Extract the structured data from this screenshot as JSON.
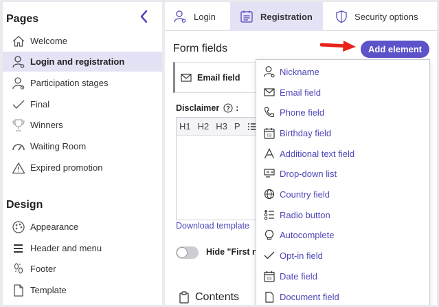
{
  "sidebar": {
    "pages_heading": "Pages",
    "design_heading": "Design",
    "pages_items": [
      {
        "label": "Welcome",
        "icon": "home-icon"
      },
      {
        "label": "Login and registration",
        "icon": "user-key-icon",
        "active": true
      },
      {
        "label": "Participation stages",
        "icon": "user-gear-icon"
      },
      {
        "label": "Final",
        "icon": "checkmark-icon"
      },
      {
        "label": "Winners",
        "icon": "trophy-icon"
      },
      {
        "label": "Waiting Room",
        "icon": "speedometer-icon"
      },
      {
        "label": "Expired promotion",
        "icon": "warning-icon"
      }
    ],
    "design_items": [
      {
        "label": "Appearance",
        "icon": "palette-icon"
      },
      {
        "label": "Header and menu",
        "icon": "hamburger-icon"
      },
      {
        "label": "Footer",
        "icon": "footprints-icon"
      },
      {
        "label": "Template",
        "icon": "document-icon"
      }
    ]
  },
  "tabs": [
    {
      "label": "Login",
      "icon": "user-key-icon"
    },
    {
      "label": "Registration",
      "icon": "calendar-list-icon",
      "active": true
    },
    {
      "label": "Security options",
      "icon": "shield-icon"
    }
  ],
  "main": {
    "form_fields_title": "Form fields",
    "add_element_label": "Add element",
    "email_field_label": "Email field",
    "disclaimer_label": "Disclaimer",
    "disclaimer_suffix": ":",
    "editor_toolbar": [
      "H1",
      "H2",
      "H3",
      "P"
    ],
    "download_link": "Download template",
    "hide_label": "Hide \"First n",
    "contents_label": "Contents"
  },
  "dropdown": {
    "items": [
      {
        "label": "Nickname",
        "icon": "user-icon"
      },
      {
        "label": "Email field",
        "icon": "envelope-icon"
      },
      {
        "label": "Phone field",
        "icon": "phone-icon"
      },
      {
        "label": "Birthday field",
        "icon": "calendar-icon"
      },
      {
        "label": "Additional text field",
        "icon": "letter-a-icon"
      },
      {
        "label": "Drop-down list",
        "icon": "dropdown-list-icon"
      },
      {
        "label": "Country field",
        "icon": "globe-icon"
      },
      {
        "label": "Radio button",
        "icon": "radio-list-icon"
      },
      {
        "label": "Autocomplete",
        "icon": "bulb-icon"
      },
      {
        "label": "Opt-in field",
        "icon": "checkmark-icon"
      },
      {
        "label": "Date field",
        "icon": "calendar-icon"
      },
      {
        "label": "Document field",
        "icon": "document-icon"
      }
    ]
  },
  "colors": {
    "accent": "#5c52c9",
    "link": "#4d46b8",
    "active_bg": "#e4e2f5",
    "arrow": "#e8221b"
  }
}
